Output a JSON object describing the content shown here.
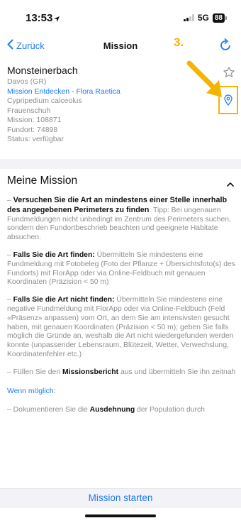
{
  "status": {
    "time": "13:53",
    "network": "5G",
    "battery": "88"
  },
  "nav": {
    "back_label": "Zurück",
    "title": "Mission",
    "step_label": "3."
  },
  "species": {
    "name": "Monsteinerbach",
    "lines": [
      {
        "text": "Davos (GR)",
        "link": false
      },
      {
        "text": "Mission Entdecken - Flora Raetica",
        "link": true
      },
      {
        "text": "Cypripedium calceolus",
        "link": false
      },
      {
        "text": "Frauenschuh",
        "link": false
      },
      {
        "text": "Mission: 108871",
        "link": false
      },
      {
        "text": "Fundort: 74898",
        "link": false
      },
      {
        "text": "Status: verfügbar",
        "link": false
      }
    ]
  },
  "mission": {
    "title": "Meine Mission",
    "items": [
      {
        "prefix": "– ",
        "bold": "Versuchen Sie die Art an mindestens einer Stelle innerhalb des angegebenen Perimeters zu finden",
        "text": ". Tipp: Bei ungenauen Fundmeldungen nicht unbedingt im Zentrum des Perimeters suchen, sondern den Fundortbeschrieb beachten und geeignete Habitate absuchen."
      },
      {
        "prefix": "– ",
        "bold": "Falls Sie die Art finden:",
        "text": " Übermitteln Sie mindestens eine Fundmeldung mit Fotobeleg (Foto der Pflanze + Übersichtsfoto(s) des Fundorts) mit FlorApp oder via Online-Feldbuch mit genauen Koordinaten (Präzision < 50 m)"
      },
      {
        "prefix": "– ",
        "bold": "Falls Sie die Art nicht finden:",
        "text": " Übermitteln Sie mindestens eine negative Fundmeldung mit FlorApp oder via Online-Feldbuch (Feld «Präsenz» anpassen) vom Ort, an dem Sie am intensivsten gesucht haben, mit genauen Koordinaten (Präzision < 50 m); geben Sie falls möglich die Gründe an, weshalb die Art nicht wiedergefunden werden konnte (unpassender Lebensraum, Blütezeit, Wetter, Verwechslung, Koordinatenfehler etc.)"
      },
      {
        "prefix": "– Füllen Sie den ",
        "bold": "Missionsbericht",
        "text": " aus und übermitteln Sie ihn zeitnah"
      }
    ],
    "if_possible_label": "Wenn möglich:",
    "extra": {
      "prefix": "– Dokumentieren Sie die ",
      "bold": "Ausdehnung",
      "text": " der Population durch"
    }
  },
  "footer": {
    "start_label": "Mission starten"
  },
  "colors": {
    "accent": "#1e7cf2",
    "highlight": "#f5b400"
  }
}
